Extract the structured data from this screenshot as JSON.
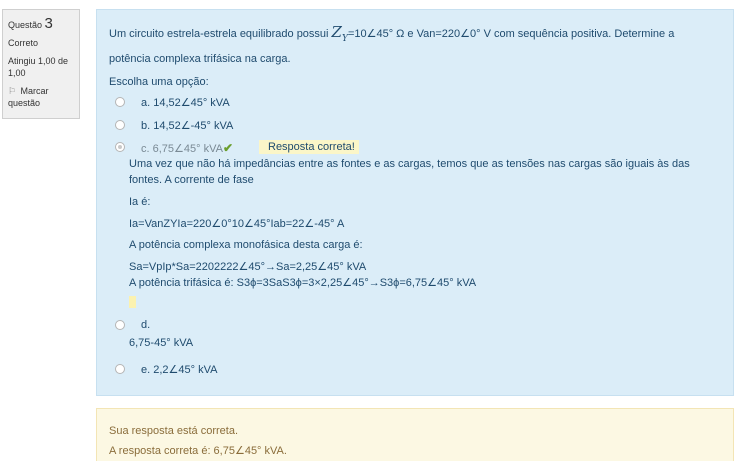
{
  "info": {
    "question_label": "Questão",
    "question_number": "3",
    "state": "Correto",
    "grade": "Atingiu 1,00 de 1,00",
    "flag_label": "Marcar questão",
    "flag_icon": "flag-icon"
  },
  "question": {
    "text_before": "Um circuito estrela-estrela equilibrado possui",
    "z_symbol": "Z",
    "z_sub": "Y",
    "text_after": "=10∠45° Ω e Van=220∠0° V com sequência positiva. Determine a potência complexa trifásica na carga.",
    "prompt": "Escolha uma opção:"
  },
  "options": [
    {
      "label": "a. 14,52∠45° kVA"
    },
    {
      "label": "b. 14,52∠-45° kVA"
    },
    {
      "label": "c. 6,75∠45° kVA",
      "check": "✔",
      "tag": "Resposta correta!"
    },
    {
      "label": "d.",
      "extra": "6,75-45° kVA"
    },
    {
      "label": "e. 2,2∠45° kVA"
    }
  ],
  "feedback": {
    "line1": "Uma vez que não há impedâncias entre as fontes e as cargas, temos que as tensões nas cargas são iguais às das fontes. A corrente de fase",
    "line2": "Ia é:",
    "line3": "Ia=VanZYIa=220∠0°10∠45°Iab=22∠-45° A",
    "line4": "A potência complexa monofásica desta carga é:",
    "line5": "Sa=VpIp*Sa=2202222∠45°→Sa=2,25∠45° kVA",
    "line6": "A potência trifásica é: S3ϕ=3SaS3ϕ=3×2,25∠45°→S3ϕ=6,75∠45° kVA"
  },
  "outcome": {
    "line1": "Sua resposta está correta.",
    "line2": "A resposta correta é: 6,75∠45° kVA."
  }
}
